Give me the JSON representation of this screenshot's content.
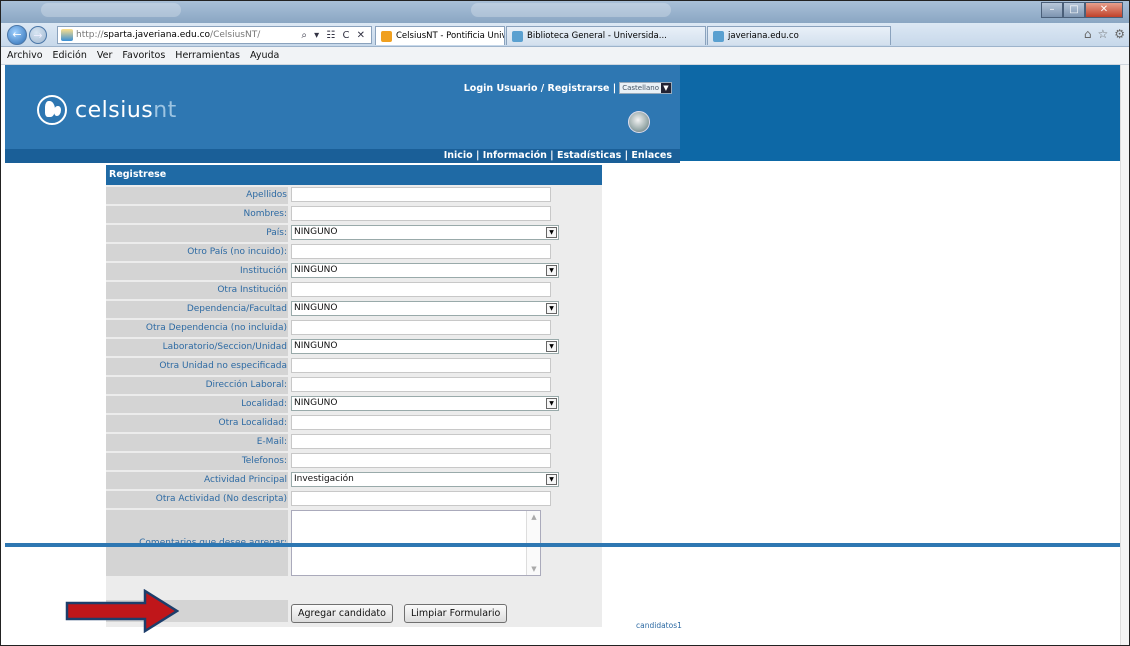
{
  "browser": {
    "url_prefix": "http://",
    "url_host": "sparta.javeriana.edu.co",
    "url_path": "/CelsiusNT/",
    "address_controls": "⌕ ▾ ☷ C ✕",
    "tabs": [
      {
        "label": "CelsiusNT - Pontificia Unive...",
        "close": "×",
        "icon_color": "#f0a020"
      },
      {
        "label": "Biblioteca General - Universida...",
        "icon_color": "#5aa0d0"
      },
      {
        "label": "javeriana.edu.co",
        "icon_color": "#5aa0d0"
      }
    ],
    "menu": [
      "Archivo",
      "Edición",
      "Ver",
      "Favoritos",
      "Herramientas",
      "Ayuda"
    ],
    "nav_back_icon": "←",
    "nav_fwd_icon": "→",
    "right_icons": [
      "⌂",
      "☆",
      "⚙"
    ],
    "window_buttons": {
      "min": "–",
      "max": "□",
      "close": "✕"
    }
  },
  "site": {
    "logo_main": "celsius",
    "logo_accent": "nt",
    "login": "Login Usuario / Registrarse |",
    "language": "Castellano",
    "nav": "Inicio | Información | Estadísticas | Enlaces"
  },
  "form": {
    "title": "Registrese",
    "fields": [
      {
        "label": "Apellidos",
        "type": "text",
        "value": ""
      },
      {
        "label": "Nombres:",
        "type": "text",
        "value": ""
      },
      {
        "label": "País:",
        "type": "select",
        "value": "NINGUNO"
      },
      {
        "label": "Otro País (no incuido):",
        "type": "text",
        "value": ""
      },
      {
        "label": "Institución",
        "type": "select",
        "value": "NINGUNO"
      },
      {
        "label": "Otra Institución",
        "type": "text",
        "value": ""
      },
      {
        "label": "Dependencia/Facultad",
        "type": "select",
        "value": "NINGUNO"
      },
      {
        "label": "Otra Dependencia (no incluida)",
        "type": "text",
        "value": ""
      },
      {
        "label": "Laboratorio/Seccion/Unidad",
        "type": "select",
        "value": "NINGUNO"
      },
      {
        "label": "Otra Unidad no especificada",
        "type": "text",
        "value": ""
      },
      {
        "label": "Dirección Laboral:",
        "type": "text",
        "value": ""
      },
      {
        "label": "Localidad:",
        "type": "select",
        "value": "NINGUNO"
      },
      {
        "label": "Otra Localidad:",
        "type": "text",
        "value": ""
      },
      {
        "label": "E-Mail:",
        "type": "text",
        "value": ""
      },
      {
        "label": "Telefonos:",
        "type": "text",
        "value": ""
      },
      {
        "label": "Actividad Principal",
        "type": "select",
        "value": "Investigación"
      },
      {
        "label": "Otra Actividad (No descripta)",
        "type": "text",
        "value": ""
      }
    ],
    "comments_label": "Comentarios que desee agregar:",
    "scroll_up": "▲",
    "scroll_down": "▼",
    "dropdown_glyph": "▼",
    "submit_label": "Agregar candidato",
    "reset_label": "Limpiar Formulario",
    "footer_id": "candidatos1"
  },
  "colors": {
    "header_blue": "#2e77b2",
    "label_text": "#2d6aa3",
    "arrow_red": "#c0161a",
    "arrow_border": "#1d3e6b"
  }
}
